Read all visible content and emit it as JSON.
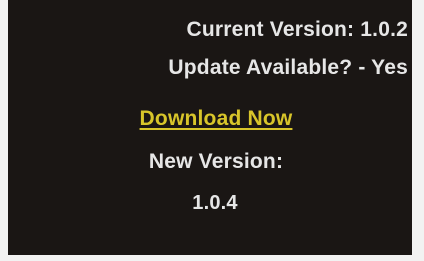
{
  "version_info": {
    "current_version_text": "Current Version: 1.0.2",
    "update_available_text": "Update Available? - Yes",
    "download_link_label": "Download Now",
    "new_version_label": "New Version:",
    "new_version_value": "1.0.4"
  },
  "colors": {
    "panel_background": "#1a1614",
    "text": "#e6e6e6",
    "link": "#d8c52a",
    "page_background": "#f2f2f2"
  }
}
